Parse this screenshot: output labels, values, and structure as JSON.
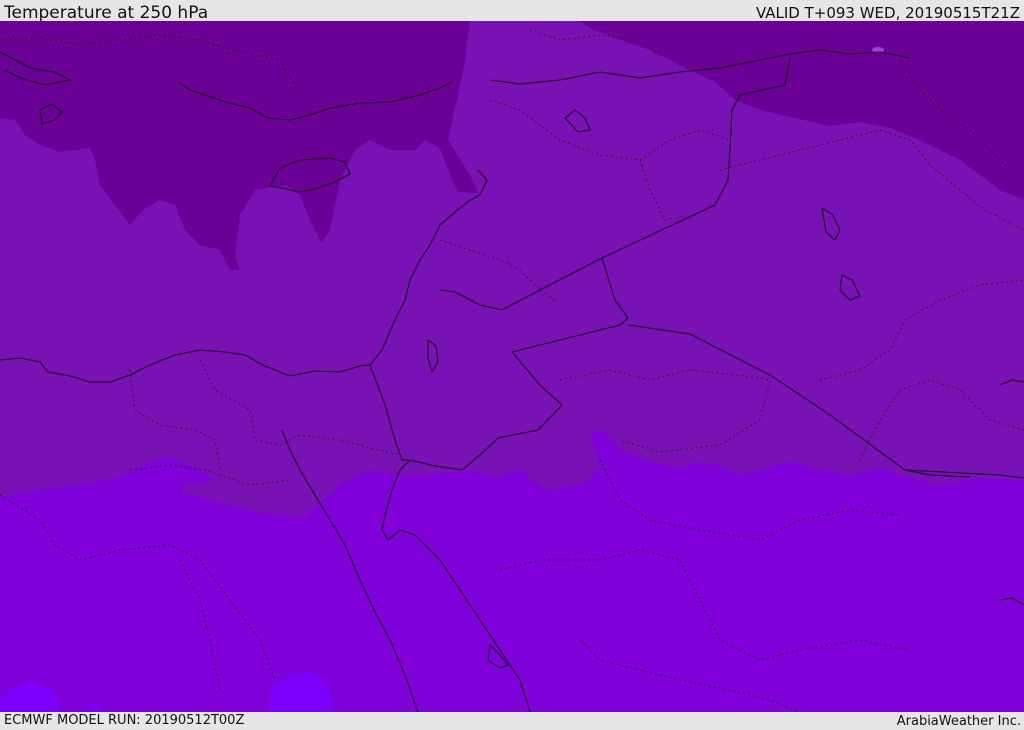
{
  "header": {
    "title": "Temperature at 250 hPa",
    "valid": "VALID T+093 WED, 20190515T21Z"
  },
  "footer": {
    "model_run": "ECMWF MODEL RUN: 20190512T00Z",
    "credit": "ArabiaWeather Inc."
  },
  "map": {
    "colors": {
      "coldest_band": "#6a0096",
      "cold_band": "#7812b4",
      "mid_band": "#7f00d8",
      "warm_patch": "#7d00ff",
      "border_line": "#111111"
    }
  }
}
